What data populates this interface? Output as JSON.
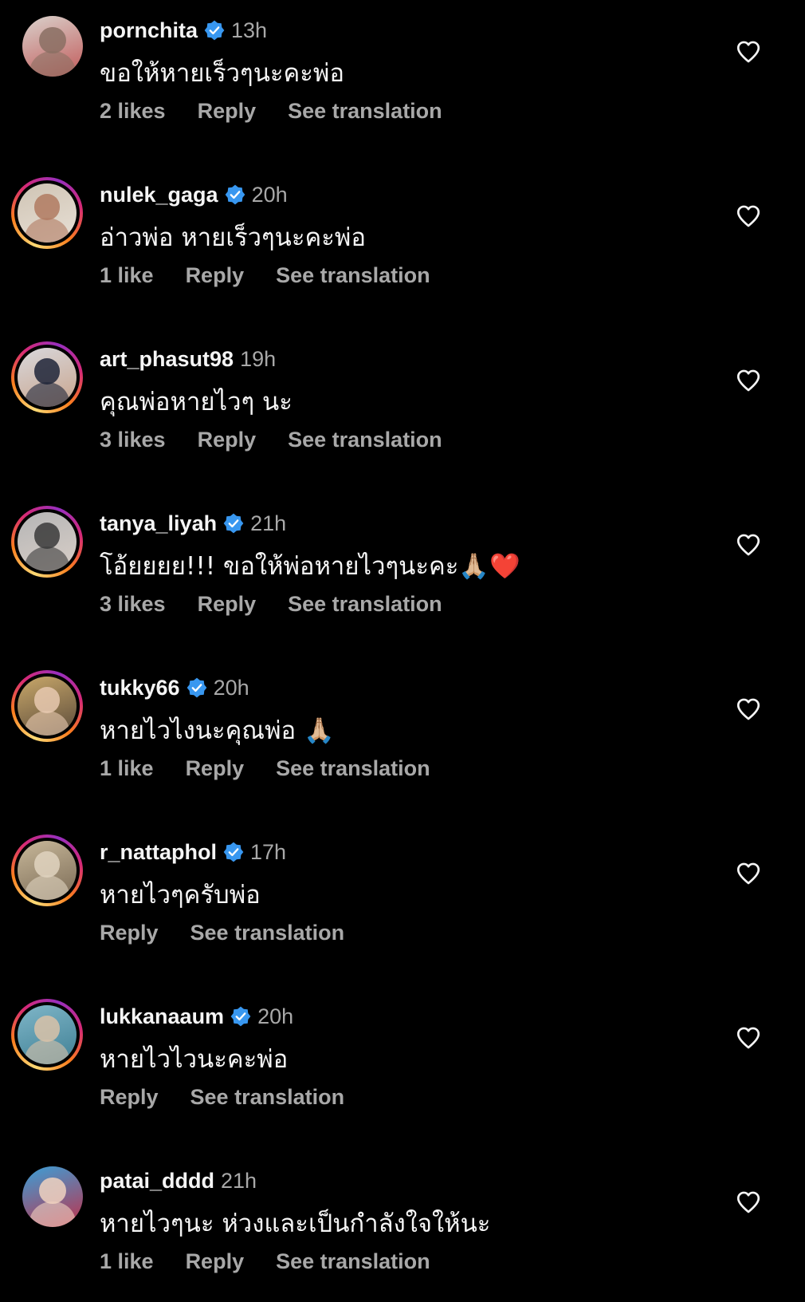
{
  "colors": {
    "background": "#000000",
    "text": "#f5f5f5",
    "secondary": "#a8a8a8",
    "verified": "#3897f0"
  },
  "comments": [
    {
      "username": "pornchita",
      "verified": true,
      "time": "13h",
      "text": "ขอให้หายเร็วๆนะคะพ่อ",
      "likes": "2 likes",
      "reply": "Reply",
      "translate": "See translation",
      "story_ring": false,
      "avatar_colors": [
        "#d9d2cc",
        "#8a6f63",
        "#c25a5a"
      ]
    },
    {
      "username": "nulek_gaga",
      "verified": true,
      "time": "20h",
      "text": "อ่าวพ่อ  หายเร็วๆนะคะพ่อ",
      "likes": "1 like",
      "reply": "Reply",
      "translate": "See translation",
      "story_ring": true,
      "avatar_colors": [
        "#cfc4b4",
        "#b07a60",
        "#e8e0d6"
      ]
    },
    {
      "username": "art_phasut98",
      "verified": false,
      "time": "19h",
      "text": "คุณพ่อหายไวๆ นะ",
      "likes": "3 likes",
      "reply": "Reply",
      "translate": "See translation",
      "story_ring": true,
      "avatar_colors": [
        "#d8d8dc",
        "#1e2538",
        "#c9a48c"
      ]
    },
    {
      "username": "tanya_liyah",
      "verified": true,
      "time": "21h",
      "text": "โอ้ยยยย!!! ขอให้พ่อหายไวๆนะคะ🙏🏼❤️",
      "likes": "3 likes",
      "reply": "Reply",
      "translate": "See translation",
      "story_ring": true,
      "avatar_colors": [
        "#b5b5b5",
        "#3a3a3a",
        "#d9cfc8"
      ]
    },
    {
      "username": "tukky66",
      "verified": true,
      "time": "20h",
      "text": "หายไวไงนะคุณพ่อ 🙏🏼",
      "likes": "1 like",
      "reply": "Reply",
      "translate": "See translation",
      "story_ring": true,
      "avatar_colors": [
        "#c9a86a",
        "#e8c9b0",
        "#5a4a3a"
      ]
    },
    {
      "username": "r_nattaphol",
      "verified": true,
      "time": "17h",
      "text": "หายไวๆครับพ่อ",
      "likes": "",
      "reply": "Reply",
      "translate": "See translation",
      "story_ring": true,
      "avatar_colors": [
        "#c8b89a",
        "#e0d4c0",
        "#7a6a55"
      ]
    },
    {
      "username": "lukkanaaum",
      "verified": true,
      "time": "20h",
      "text": "หายไวไวนะคะพ่อ",
      "likes": "",
      "reply": "Reply",
      "translate": "See translation",
      "story_ring": true,
      "avatar_colors": [
        "#7fb6c8",
        "#d9c2a8",
        "#3f7f94"
      ]
    },
    {
      "username": "patai_dddd",
      "verified": false,
      "time": "21h",
      "text": "หายไวๆนะ ห่วงและเป็นกำลังใจให้นะ",
      "likes": "1 like",
      "reply": "Reply",
      "translate": "See translation",
      "story_ring": false,
      "avatar_colors": [
        "#3aa0d8",
        "#f0d2c0",
        "#c0304a"
      ]
    }
  ]
}
